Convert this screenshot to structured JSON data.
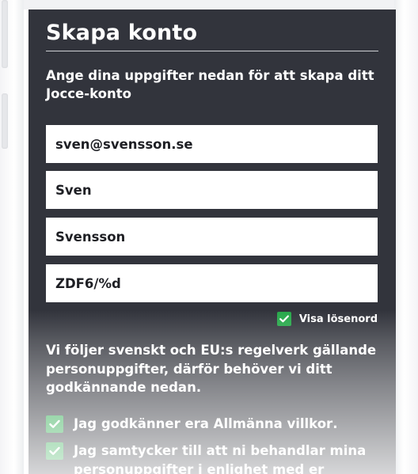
{
  "form": {
    "title": "Skapa konto",
    "subtitle": "Ange dina uppgifter nedan för att skapa ditt Jocce-konto",
    "email_value": "sven@svensson.se",
    "first_name_value": "Sven",
    "last_name_value": "Svensson",
    "password_value": "ZDF6/%d",
    "show_password_label": "Visa lösenord",
    "show_password_checked": true,
    "info_text": "Vi följer svenskt och EU:s regelverk gällande personuppgifter, därför behöver vi ditt godkännande nedan.",
    "terms_prefix": "Jag godkänner era ",
    "terms_link": "Allmänna villkor",
    "terms_suffix": ".",
    "terms_checked": true,
    "consent_text": "Jag samtycker till att ni behandlar mina personuppgifter i enlighet med er",
    "consent_checked": true
  },
  "colors": {
    "background": "#32343c",
    "field_background": "#ffffff",
    "checkbox_green": "#27a84a",
    "text": "#ffffff"
  },
  "icons": {
    "checkbox": "checkmark-icon"
  }
}
